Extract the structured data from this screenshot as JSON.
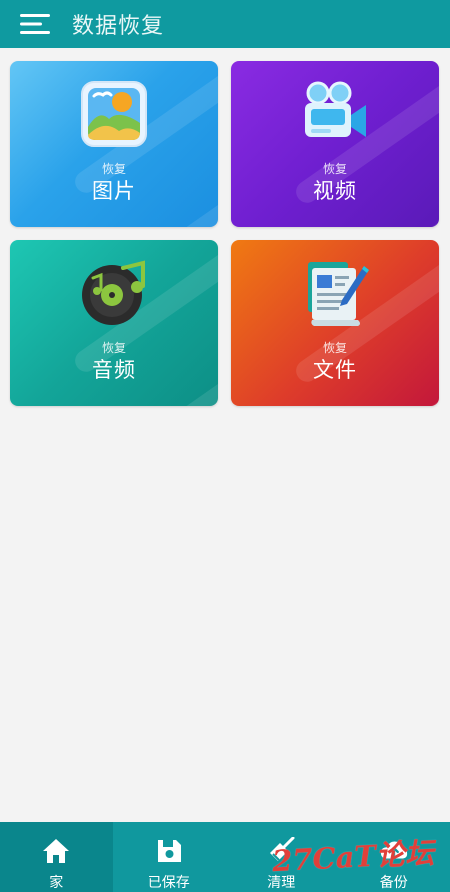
{
  "appbar": {
    "title": "数据恢复",
    "menu_icon": "hamburger-menu-icon"
  },
  "cards": [
    {
      "id": "photos",
      "subtitle": "恢复",
      "title": "图片",
      "icon": "photo-gallery-icon",
      "color": "#2aa2ea"
    },
    {
      "id": "video",
      "subtitle": "恢复",
      "title": "视频",
      "icon": "video-camera-icon",
      "color": "#6f1fd0"
    },
    {
      "id": "audio",
      "subtitle": "恢复",
      "title": "音频",
      "icon": "music-disc-icon",
      "color": "#13a599"
    },
    {
      "id": "docs",
      "subtitle": "恢复",
      "title": "文件",
      "icon": "document-edit-icon",
      "color": "#de3d2a"
    }
  ],
  "bottom_nav": {
    "items": [
      {
        "label": "家",
        "icon": "home-icon",
        "active": true
      },
      {
        "label": "已保存",
        "icon": "save-disk-icon",
        "active": false
      },
      {
        "label": "清理",
        "icon": "broom-clean-icon",
        "active": false
      },
      {
        "label": "备份",
        "icon": "cloud-backup-icon",
        "active": false
      }
    ]
  },
  "watermark": "27CaT论坛",
  "colors": {
    "primary": "#0f9aa0",
    "nav_active": "#0a868c",
    "background": "#f3f3f3"
  }
}
